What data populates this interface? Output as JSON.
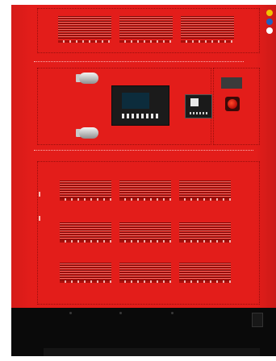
{
  "image": {
    "subject": "generator-enclosure",
    "colors": {
      "enclosure": "#e31d1a",
      "louver_shadow": "#7b0a08",
      "louver_highlight": "#f06a62",
      "base": "#0a0a0a",
      "controller": "#1b1b1b",
      "handle": "#c9c9c9",
      "emergency_stop": "#d0160e"
    },
    "icons": {
      "handle": "door-handle-icon",
      "controller": "control-panel-icon",
      "breaker": "circuit-breaker-icon",
      "stop": "emergency-stop-icon"
    },
    "upper_louver_count": 3,
    "lower_louver_rows": 3,
    "lower_louver_columns": 3
  }
}
